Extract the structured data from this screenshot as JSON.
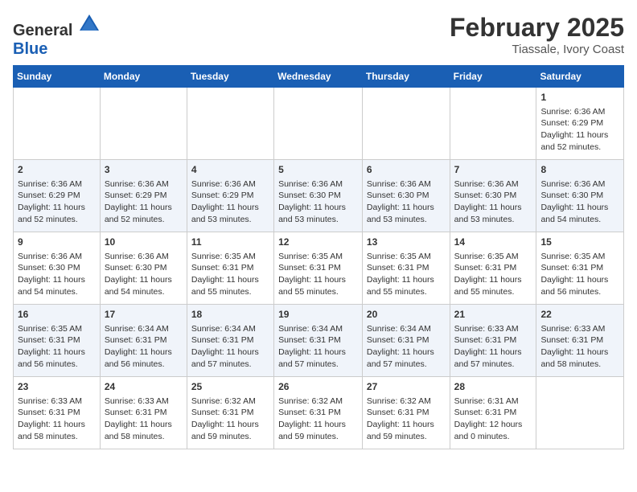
{
  "header": {
    "logo_general": "General",
    "logo_blue": "Blue",
    "month_year": "February 2025",
    "location": "Tiassale, Ivory Coast"
  },
  "days_of_week": [
    "Sunday",
    "Monday",
    "Tuesday",
    "Wednesday",
    "Thursday",
    "Friday",
    "Saturday"
  ],
  "weeks": [
    [
      {
        "day": "",
        "content": ""
      },
      {
        "day": "",
        "content": ""
      },
      {
        "day": "",
        "content": ""
      },
      {
        "day": "",
        "content": ""
      },
      {
        "day": "",
        "content": ""
      },
      {
        "day": "",
        "content": ""
      },
      {
        "day": "1",
        "content": "Sunrise: 6:36 AM\nSunset: 6:29 PM\nDaylight: 11 hours and 52 minutes."
      }
    ],
    [
      {
        "day": "2",
        "content": "Sunrise: 6:36 AM\nSunset: 6:29 PM\nDaylight: 11 hours and 52 minutes."
      },
      {
        "day": "3",
        "content": "Sunrise: 6:36 AM\nSunset: 6:29 PM\nDaylight: 11 hours and 52 minutes."
      },
      {
        "day": "4",
        "content": "Sunrise: 6:36 AM\nSunset: 6:29 PM\nDaylight: 11 hours and 53 minutes."
      },
      {
        "day": "5",
        "content": "Sunrise: 6:36 AM\nSunset: 6:30 PM\nDaylight: 11 hours and 53 minutes."
      },
      {
        "day": "6",
        "content": "Sunrise: 6:36 AM\nSunset: 6:30 PM\nDaylight: 11 hours and 53 minutes."
      },
      {
        "day": "7",
        "content": "Sunrise: 6:36 AM\nSunset: 6:30 PM\nDaylight: 11 hours and 53 minutes."
      },
      {
        "day": "8",
        "content": "Sunrise: 6:36 AM\nSunset: 6:30 PM\nDaylight: 11 hours and 54 minutes."
      }
    ],
    [
      {
        "day": "9",
        "content": "Sunrise: 6:36 AM\nSunset: 6:30 PM\nDaylight: 11 hours and 54 minutes."
      },
      {
        "day": "10",
        "content": "Sunrise: 6:36 AM\nSunset: 6:30 PM\nDaylight: 11 hours and 54 minutes."
      },
      {
        "day": "11",
        "content": "Sunrise: 6:35 AM\nSunset: 6:31 PM\nDaylight: 11 hours and 55 minutes."
      },
      {
        "day": "12",
        "content": "Sunrise: 6:35 AM\nSunset: 6:31 PM\nDaylight: 11 hours and 55 minutes."
      },
      {
        "day": "13",
        "content": "Sunrise: 6:35 AM\nSunset: 6:31 PM\nDaylight: 11 hours and 55 minutes."
      },
      {
        "day": "14",
        "content": "Sunrise: 6:35 AM\nSunset: 6:31 PM\nDaylight: 11 hours and 55 minutes."
      },
      {
        "day": "15",
        "content": "Sunrise: 6:35 AM\nSunset: 6:31 PM\nDaylight: 11 hours and 56 minutes."
      }
    ],
    [
      {
        "day": "16",
        "content": "Sunrise: 6:35 AM\nSunset: 6:31 PM\nDaylight: 11 hours and 56 minutes."
      },
      {
        "day": "17",
        "content": "Sunrise: 6:34 AM\nSunset: 6:31 PM\nDaylight: 11 hours and 56 minutes."
      },
      {
        "day": "18",
        "content": "Sunrise: 6:34 AM\nSunset: 6:31 PM\nDaylight: 11 hours and 57 minutes."
      },
      {
        "day": "19",
        "content": "Sunrise: 6:34 AM\nSunset: 6:31 PM\nDaylight: 11 hours and 57 minutes."
      },
      {
        "day": "20",
        "content": "Sunrise: 6:34 AM\nSunset: 6:31 PM\nDaylight: 11 hours and 57 minutes."
      },
      {
        "day": "21",
        "content": "Sunrise: 6:33 AM\nSunset: 6:31 PM\nDaylight: 11 hours and 57 minutes."
      },
      {
        "day": "22",
        "content": "Sunrise: 6:33 AM\nSunset: 6:31 PM\nDaylight: 11 hours and 58 minutes."
      }
    ],
    [
      {
        "day": "23",
        "content": "Sunrise: 6:33 AM\nSunset: 6:31 PM\nDaylight: 11 hours and 58 minutes."
      },
      {
        "day": "24",
        "content": "Sunrise: 6:33 AM\nSunset: 6:31 PM\nDaylight: 11 hours and 58 minutes."
      },
      {
        "day": "25",
        "content": "Sunrise: 6:32 AM\nSunset: 6:31 PM\nDaylight: 11 hours and 59 minutes."
      },
      {
        "day": "26",
        "content": "Sunrise: 6:32 AM\nSunset: 6:31 PM\nDaylight: 11 hours and 59 minutes."
      },
      {
        "day": "27",
        "content": "Sunrise: 6:32 AM\nSunset: 6:31 PM\nDaylight: 11 hours and 59 minutes."
      },
      {
        "day": "28",
        "content": "Sunrise: 6:31 AM\nSunset: 6:31 PM\nDaylight: 12 hours and 0 minutes."
      },
      {
        "day": "",
        "content": ""
      }
    ]
  ]
}
